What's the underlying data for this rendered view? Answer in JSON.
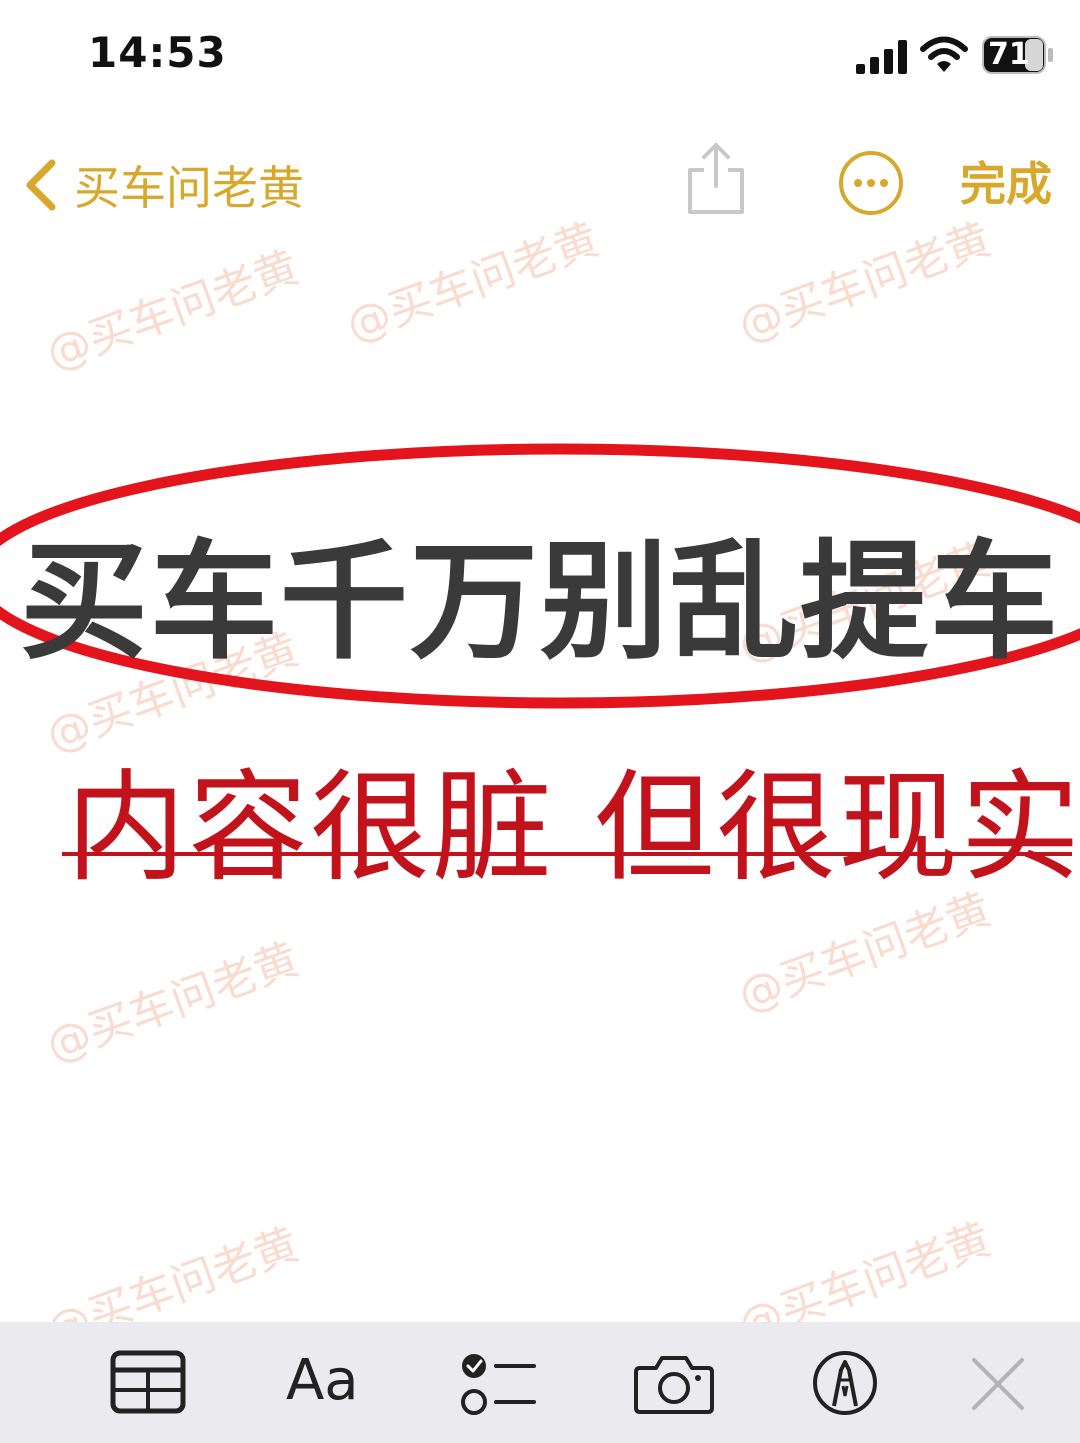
{
  "status_bar": {
    "time": "14:53",
    "battery_level": "71",
    "icons": [
      "signal-icon",
      "wifi-icon",
      "battery-icon"
    ]
  },
  "nav": {
    "back_label": "买车问老黄",
    "done_label": "完成",
    "icons": [
      "chevron-left-icon",
      "share-icon",
      "more-icon"
    ]
  },
  "note": {
    "title": "买车千万别乱提车",
    "subtitle": "内容很脏 但很现实"
  },
  "watermark": {
    "text": "@买车问老黄"
  },
  "toolbar": {
    "format_label": "Aa",
    "icons": [
      "table-icon",
      "checklist-icon",
      "camera-icon",
      "markup-pen-icon",
      "close-icon"
    ]
  },
  "colors": {
    "accent": "#D7A82B",
    "title_text": "#3a3a3a",
    "subtitle_red": "#C2121B",
    "ellipse_red": "#E3141B",
    "toolbar_bg": "#EBEBEF"
  }
}
